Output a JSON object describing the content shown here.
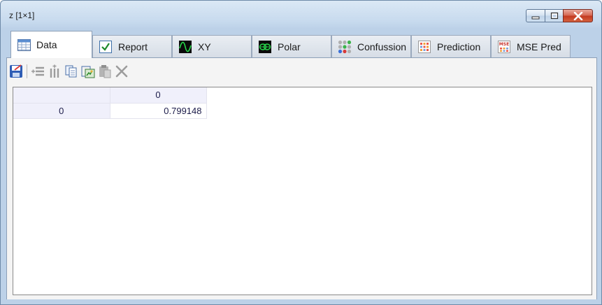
{
  "window": {
    "title": "z [1×1]"
  },
  "tabs": [
    {
      "label": "Data",
      "icon": "table-icon",
      "active": true
    },
    {
      "label": "Report",
      "icon": "checkbox-icon",
      "active": false
    },
    {
      "label": "XY",
      "icon": "sine-wave-icon",
      "active": false
    },
    {
      "label": "Polar",
      "icon": "polar-icon",
      "active": false
    },
    {
      "label": "Confussion",
      "icon": "dots-grid-icon",
      "active": false
    },
    {
      "label": "Prediction",
      "icon": "color-grid-icon",
      "active": false
    },
    {
      "label": "MSE Pred",
      "icon": "mse-icon",
      "active": false
    }
  ],
  "toolbar": {
    "buttons": [
      "save-icon",
      "insert-rows-icon",
      "insert-columns-icon",
      "copy-icon",
      "paste-special-icon",
      "paste-icon",
      "delete-icon"
    ]
  },
  "grid": {
    "column_headers": [
      "0"
    ],
    "rows": [
      {
        "header": "0",
        "cells": [
          "0.799148"
        ]
      }
    ]
  },
  "colors": {
    "accent": "#c2381e",
    "header_bg": "#f0f0fb",
    "frame": "#bcd1e8"
  }
}
